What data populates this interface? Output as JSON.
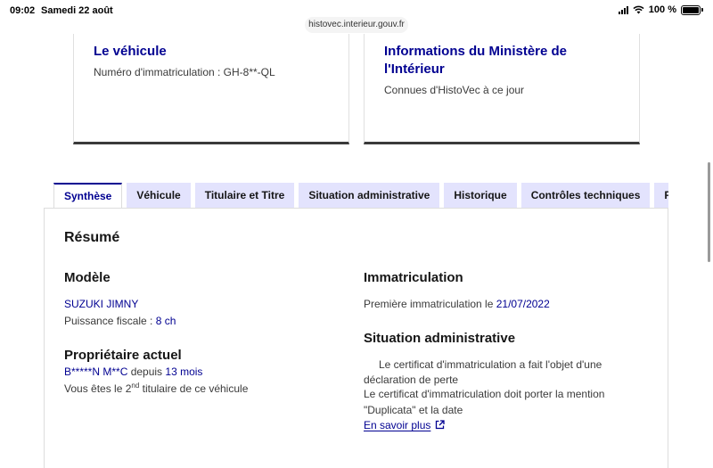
{
  "status_bar": {
    "time": "09:02",
    "date": "Samedi 22 août",
    "battery": "100 %",
    "battery_level": 1.0,
    "url": "histovec.interieur.gouv.fr"
  },
  "cards": {
    "vehicle": {
      "title": "Le véhicule",
      "subtitle": "Numéro d'immatriculation : GH-8**-QL"
    },
    "ministry": {
      "title": "Informations du Ministère de l'Intérieur",
      "subtitle": "Connues d'HistoVec à ce jour"
    }
  },
  "tabs": [
    {
      "label": "Synthèse",
      "active": true
    },
    {
      "label": "Véhicule",
      "active": false
    },
    {
      "label": "Titulaire et Titre",
      "active": false
    },
    {
      "label": "Situation administrative",
      "active": false
    },
    {
      "label": "Historique",
      "active": false
    },
    {
      "label": "Contrôles techniques",
      "active": false
    },
    {
      "label": "Rap",
      "active": false
    }
  ],
  "summary": {
    "title": "Résumé",
    "model": {
      "heading": "Modèle",
      "name": "SUZUKI JIMNY",
      "power_label": "Puissance fiscale : ",
      "power_value": "8 ch"
    },
    "owner": {
      "heading": "Propriétaire actuel",
      "name": "B*****N M**C",
      "since_label": " depuis ",
      "since_value": "13 mois",
      "rank_prefix": "Vous êtes le 2",
      "rank_sup": "nd",
      "rank_suffix": " titulaire de ce véhicule"
    },
    "registration": {
      "heading": "Immatriculation",
      "first_label": "Première immatriculation le ",
      "first_date": "21/07/2022"
    },
    "admin": {
      "heading": "Situation administrative",
      "line1": "Le certificat d'immatriculation a fait l'objet d'une",
      "line2": "déclaration de perte",
      "line3": "Le certificat d'immatriculation doit porter la mention",
      "line4": "\"Duplicata\" et la date",
      "link": "En savoir plus"
    }
  }
}
